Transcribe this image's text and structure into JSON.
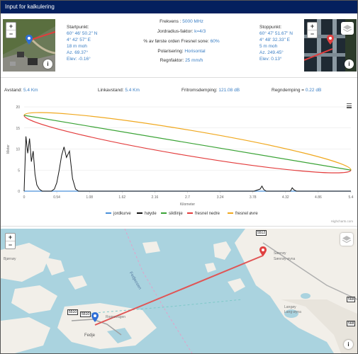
{
  "header": {
    "title": "Input for kalkulering"
  },
  "start": {
    "title": "Startpunkt:",
    "lat": "60° 46' 50.2\" N",
    "lon": "4° 42' 57\" E",
    "height": "18 m moh",
    "az": "Az. 69.37°",
    "elev": "Elev: -0.16°"
  },
  "stop": {
    "title": "Stoppunkt:",
    "lat": "60° 47' 51.67\" N",
    "lon": "4° 48' 32.33\" E",
    "height": "5 m moh",
    "az": "Az. 249.45°",
    "elev": "Elev: 0.13°"
  },
  "params": [
    {
      "key": "Frekvens :",
      "value": "5000 MHz"
    },
    {
      "key": "Jordradius-faktor:",
      "value": "k=4/3"
    },
    {
      "key": "% av første orden Fresnel sone:",
      "value": "60%"
    },
    {
      "key": "Polarisering:",
      "value": "Horisontal"
    },
    {
      "key": "Regnfaktor:",
      "value": "25 mm/h"
    }
  ],
  "metrics": [
    {
      "key": "Avstand:",
      "value": "5.4 Km"
    },
    {
      "key": "Linkavstand:",
      "value": "5.4 Km"
    },
    {
      "key": "Fritromsdemping:",
      "value": "121.08 dB"
    },
    {
      "key": "Regndemping =",
      "value": "0.22 dB"
    }
  ],
  "map_controls": {
    "zoom_in": "+",
    "zoom_out": "−",
    "info": "i"
  },
  "chart_data": {
    "type": "line",
    "xlabel": "Kilometer",
    "ylabel": "Meter",
    "xlim": [
      0,
      5.4
    ],
    "ylim": [
      0,
      20
    ],
    "x_ticks": [
      "0",
      "0.54",
      "1.08",
      "1.62",
      "2.16",
      "2.7",
      "3.24",
      "3.78",
      "4.32",
      "4.86",
      "5.4"
    ],
    "y_ticks": [
      "0",
      "5",
      "10",
      "15",
      "20"
    ],
    "series": [
      {
        "name": "jordkurve",
        "color": "#4a90d9",
        "x": [
          0,
          5.4
        ],
        "y": [
          0,
          0
        ]
      },
      {
        "name": "høyde",
        "color": "#111111",
        "x": [
          0,
          0.03,
          0.06,
          0.09,
          0.12,
          0.15,
          0.18,
          0.21,
          0.25,
          0.3,
          0.35,
          0.4,
          0.45,
          0.5,
          0.54,
          0.58,
          0.62,
          0.66,
          0.7,
          0.75,
          0.8,
          0.85,
          0.9,
          1.0,
          1.5,
          2.0,
          2.5,
          3.0,
          3.5,
          3.8,
          3.9,
          3.93,
          3.96,
          4.0,
          4.3,
          4.4,
          4.43,
          4.46,
          4.5,
          5.0,
          5.4
        ],
        "y": [
          0,
          13,
          9,
          12.5,
          7,
          9.5,
          4,
          1.5,
          0.5,
          0,
          0,
          0,
          0,
          0.5,
          2,
          5,
          8.5,
          10.5,
          8,
          9.5,
          3,
          0.5,
          0,
          0,
          0,
          0,
          0,
          0,
          0,
          0,
          0.5,
          1.2,
          0.4,
          0,
          0,
          0,
          0.8,
          0.3,
          0,
          0,
          0
        ]
      },
      {
        "name": "siktlinje",
        "color": "#3aa335",
        "x": [
          0,
          5.4
        ],
        "y": [
          18,
          5
        ]
      },
      {
        "name": "fresnel nedre",
        "color": "#e33c3c"
      },
      {
        "name": "fresnel øvre",
        "color": "#f0a81e"
      }
    ],
    "legend_position": "bottom"
  },
  "chart_credit": "Highcharts.com",
  "bottom_map": {
    "labels": [
      "Fedjeosen",
      "Fedje",
      "Rognsvågen",
      "Sævrøy",
      "Sævrøy-øyna",
      "Langøy",
      "Lang-øyna",
      "Bjørnøy"
    ],
    "road_labels": [
      "5510",
      "5512",
      "568"
    ]
  }
}
